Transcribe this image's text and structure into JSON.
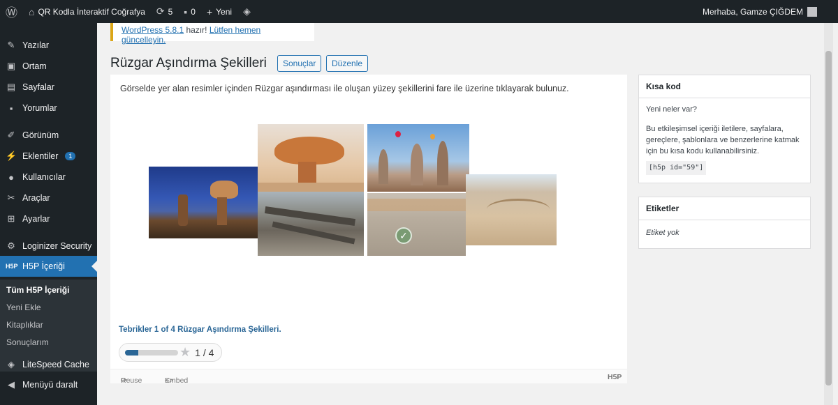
{
  "adminbar": {
    "site_name": "QR Kodla İnteraktif Coğrafya",
    "updates_count": "5",
    "comments_count": "0",
    "new_label": "Yeni",
    "greeting": "Merhaba, Gamze ÇIĞDEM"
  },
  "sidebar": {
    "items": [
      {
        "label": "Yazılar",
        "icon": "pin-icon"
      },
      {
        "label": "Ortam",
        "icon": "media-icon"
      },
      {
        "label": "Sayfalar",
        "icon": "pages-icon"
      },
      {
        "label": "Yorumlar",
        "icon": "comments-icon"
      },
      {
        "label": "Görünüm",
        "icon": "appearance-icon"
      },
      {
        "label": "Eklentiler",
        "icon": "plugins-icon",
        "badge": "1"
      },
      {
        "label": "Kullanıcılar",
        "icon": "users-icon"
      },
      {
        "label": "Araçlar",
        "icon": "tools-icon"
      },
      {
        "label": "Ayarlar",
        "icon": "settings-icon"
      },
      {
        "label": "Loginizer Security",
        "icon": "gear-icon"
      },
      {
        "label": "H5P İçeriği",
        "icon": "h5p-icon"
      },
      {
        "label": "LiteSpeed Cache",
        "icon": "litespeed-icon"
      },
      {
        "label": "Menüyü daralt",
        "icon": "collapse-icon"
      }
    ],
    "submenu": [
      "Tüm H5P İçeriği",
      "Yeni Ekle",
      "Kitaplıklar",
      "Sonuçlarım"
    ]
  },
  "notice": {
    "version_link": "WordPress 5.8.1",
    "text": " hazır! ",
    "update_link": "Lütfen hemen güncelleyin."
  },
  "page": {
    "title": "Rüzgar Aşındırma Şekilleri",
    "results_button": "Sonuçlar",
    "edit_button": "Düzenle"
  },
  "h5p": {
    "instructions": "Görselde yer alan resimler içinden Rüzgar aşındırması ile oluşan yüzey şekillerini fare ile üzerine tıklayarak bulunuz.",
    "feedback": "Tebrikler 1 of 4 Rüzgar Aşındırma Şekilleri.",
    "score": "1 / 4",
    "score_fraction": 0.25,
    "reuse": "Reuse",
    "embed": "Embed",
    "logo": "H5P"
  },
  "shortcode_box": {
    "title": "Kısa kod",
    "whats_new": "Yeni neler var?",
    "description": "Bu etkileşimsel içeriği iletilere, sayfalara, gereçlere, şablonlara ve benzerlerine katmak için bu kısa kodu kullanabilirsiniz.",
    "code": "[h5p id=\"59\"]"
  },
  "tags_box": {
    "title": "Etiketler",
    "empty": "Etiket yok"
  },
  "colors": {
    "admin_bg": "#1d2327",
    "accent": "#2271b1",
    "feedback_blue": "#2a6696"
  }
}
